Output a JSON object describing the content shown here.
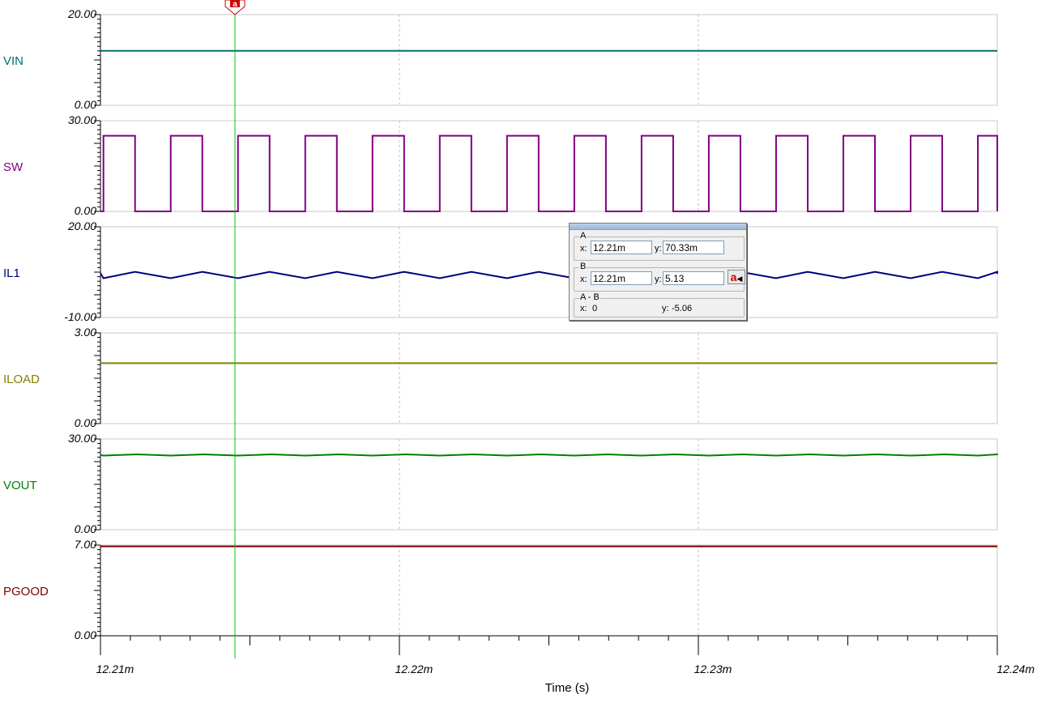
{
  "chart_data": {
    "type": "line",
    "x": {
      "min": 12.21,
      "max": 12.24,
      "ticks": [
        "12.21m",
        "12.22m",
        "12.23m",
        "12.24m"
      ],
      "label": "Time (s)"
    },
    "panels": [
      {
        "name": "VIN",
        "color": "#007070",
        "ymin_label": "0.00",
        "ymax_label": "20.00",
        "ymin": 0,
        "ymax": 20,
        "signal": {
          "kind": "dc",
          "value": 12
        }
      },
      {
        "name": "SW",
        "color": "#800080",
        "ymin_label": "0.00",
        "ymax_label": "30.00",
        "ymin": 0,
        "ymax": 30,
        "signal": {
          "kind": "pulse",
          "high": 25,
          "low": 0,
          "period_ms": 0.00225,
          "duty": 0.47,
          "first_rise_ms": 12.2101
        }
      },
      {
        "name": "IL1",
        "color": "#000080",
        "ymin_label": "-10.00",
        "ymax_label": "20.00",
        "ymin": -10,
        "ymax": 20,
        "signal": {
          "kind": "triangle",
          "high": 5.1,
          "low": 3.0,
          "period_ms": 0.00225,
          "duty": 0.47,
          "first_rise_ms": 12.2101
        }
      },
      {
        "name": "ILOAD",
        "color": "#808000",
        "ymin_label": "0.00",
        "ymax_label": "3.00",
        "ymin": 0,
        "ymax": 3,
        "signal": {
          "kind": "dc",
          "value": 2
        }
      },
      {
        "name": "VOUT",
        "color": "#008000",
        "ymin_label": "0.00",
        "ymax_label": "30.00",
        "ymin": 0,
        "ymax": 30,
        "signal": {
          "kind": "ripple",
          "value": 24.7,
          "amplitude": 0.2,
          "period_ms": 0.00225,
          "first_rise_ms": 12.2101
        }
      },
      {
        "name": "PGOOD",
        "color": "#800000",
        "ymin_label": "0.00",
        "ymax_label": "7.00",
        "ymin": 0,
        "ymax": 7,
        "signal": {
          "kind": "dc",
          "value": 6.9
        }
      }
    ],
    "cursor": {
      "label": "a",
      "x_ms": 12.2145,
      "color": "#00cc00"
    },
    "grid": true
  },
  "cursor_panel": {
    "a": {
      "label": "A",
      "x_label": "x:",
      "x": "12.21m",
      "y_label": "y:",
      "y": "70.33m"
    },
    "b": {
      "label": "B",
      "x_label": "x:",
      "x": "12.21m",
      "y_label": "y:",
      "y": "5.13",
      "button": "a"
    },
    "diff": {
      "label": "A - B",
      "x_label": "x:",
      "x": "0",
      "y_label": "y:",
      "y": "-5.06"
    }
  }
}
